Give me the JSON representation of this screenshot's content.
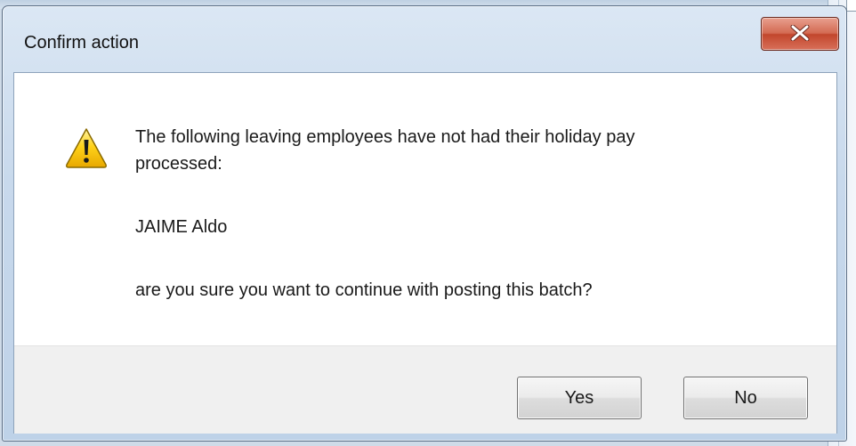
{
  "dialog": {
    "title": "Confirm action",
    "close_icon": "close-x-icon",
    "message_icon": "warning-triangle-icon",
    "message_line_1": "The following leaving employees have not had their holiday pay",
    "message_line_2": "processed:",
    "employee": "JAIME Aldo",
    "question": "are you sure you want to continue with posting this batch?",
    "buttons": {
      "yes": "Yes",
      "no": "No"
    }
  },
  "colors": {
    "frame": "#c8d9ec",
    "close_button": "#c2462c",
    "warning_fill": "#f5c400",
    "button_bar": "#f0f0f0"
  }
}
